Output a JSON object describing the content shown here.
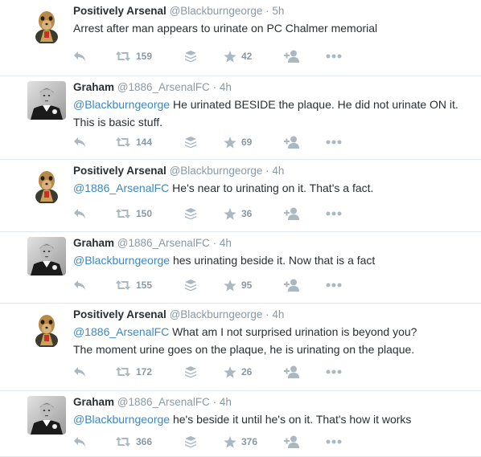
{
  "tweets": [
    {
      "name": "Positively Arsenal",
      "handle": "@Blackburngeorge",
      "sep": "·",
      "time": "5h",
      "mention": "",
      "text": "Arrest after man appears to urinate on PC Chalmer memorial",
      "text2": "",
      "retweets": "159",
      "likes": "42",
      "avatar": "meerkat"
    },
    {
      "name": "Graham",
      "handle": "@1886_ArsenalFC",
      "sep": "·",
      "time": "4h",
      "mention": "@Blackburngeorge",
      "text": " He urinated BESIDE the plaque. He did not urinate ON it.",
      "text2": "This is basic stuff.",
      "retweets": "144",
      "likes": "69",
      "avatar": "footballer"
    },
    {
      "name": "Positively Arsenal",
      "handle": "@Blackburngeorge",
      "sep": "·",
      "time": "4h",
      "mention": "@1886_ArsenalFC",
      "text": " He's near to urinating on it. That's a fact.",
      "text2": "",
      "retweets": "150",
      "likes": "36",
      "avatar": "meerkat"
    },
    {
      "name": "Graham",
      "handle": "@1886_ArsenalFC",
      "sep": "·",
      "time": "4h",
      "mention": "@Blackburngeorge",
      "text": " hes urinating beside it. Now that is a fact",
      "text2": "",
      "retweets": "155",
      "likes": "95",
      "avatar": "footballer"
    },
    {
      "name": "Positively Arsenal",
      "handle": "@Blackburngeorge",
      "sep": "·",
      "time": "4h",
      "mention": "@1886_ArsenalFC",
      "text": " What am I not surprised urination is beyond you?",
      "text2": "The moment urine goes on the plaque, he is urinating on the plaque.",
      "retweets": "172",
      "likes": "26",
      "avatar": "meerkat"
    },
    {
      "name": "Graham",
      "handle": "@1886_ArsenalFC",
      "sep": "·",
      "time": "4h",
      "mention": "@Blackburngeorge",
      "text": " he's beside it until he's on it. That's how it works",
      "text2": "",
      "retweets": "366",
      "likes": "376",
      "avatar": "footballer"
    }
  ],
  "icons": {
    "reply": "reply-icon",
    "retweet": "retweet-icon",
    "save": "stack-icon",
    "like": "star-icon",
    "follow": "follow-icon",
    "more": "more-icon"
  },
  "colors": {
    "mention": "#3b88c3",
    "action_icon": "#aab8c2",
    "meta": "#8899a6",
    "divider": "#e1e8ed"
  }
}
